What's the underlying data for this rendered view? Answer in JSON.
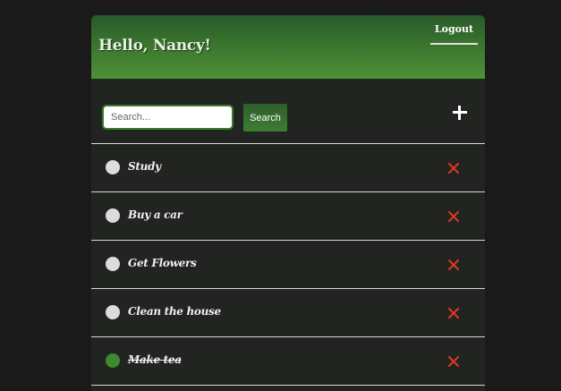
{
  "header": {
    "greeting": "Hello, Nancy!",
    "logout_label": "Logout"
  },
  "toolbar": {
    "search_placeholder": "Search...",
    "search_label": "Search",
    "add_icon": "plus-icon"
  },
  "todos": [
    {
      "text": "Study",
      "completed": false
    },
    {
      "text": "Buy a car",
      "completed": false
    },
    {
      "text": "Get Flowers",
      "completed": false
    },
    {
      "text": "Clean the house",
      "completed": false
    },
    {
      "text": "Make tea",
      "completed": true
    }
  ],
  "colors": {
    "accent": "#3d7a2f",
    "delete": "#e03a1e",
    "completed_check": "#3d8a2f",
    "pending_check": "#dcdcdc"
  }
}
